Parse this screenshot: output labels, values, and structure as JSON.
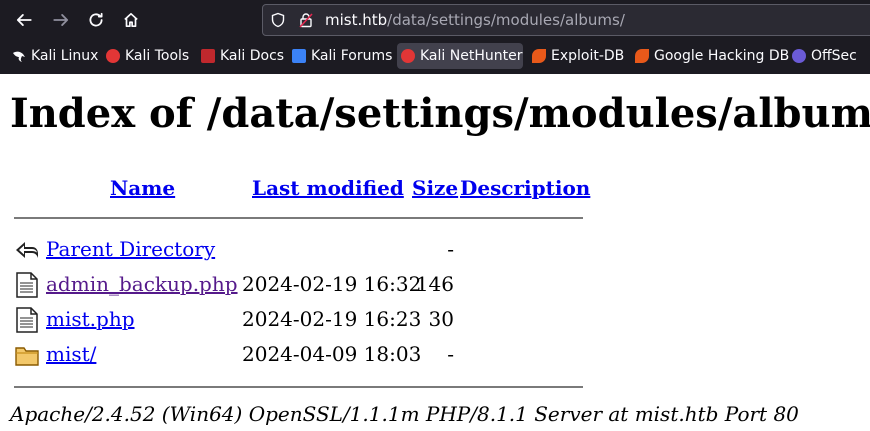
{
  "browser": {
    "url_host": "mist.htb",
    "url_path": "/data/settings/modules/albums/"
  },
  "bookmarks": [
    {
      "label": "Kali Linux",
      "icon": "kali-dragon-icon",
      "color": "#367bf0"
    },
    {
      "label": "Kali Tools",
      "icon": "kali-tools-icon",
      "color": "#e23636"
    },
    {
      "label": "Kali Docs",
      "icon": "kali-docs-icon",
      "color": "#c0282d"
    },
    {
      "label": "Kali Forums",
      "icon": "kali-forums-icon",
      "color": "#3b82f6"
    },
    {
      "label": "Kali NetHunter",
      "icon": "nethunter-icon",
      "color": "#e23636"
    },
    {
      "label": "Exploit-DB",
      "icon": "exploit-db-icon",
      "color": "#e8591a"
    },
    {
      "label": "Google Hacking DB",
      "icon": "ghdb-icon",
      "color": "#e8591a"
    },
    {
      "label": "OffSec",
      "icon": "offsec-icon",
      "color": "#6b5bd6"
    }
  ],
  "page": {
    "title": "Index of /data/settings/modules/albums",
    "columns": {
      "name": "Name",
      "modified": "Last modified",
      "size": "Size",
      "description": "Description"
    },
    "rows": [
      {
        "icon": "back-arrow-icon",
        "name": "Parent Directory",
        "modified": "",
        "size": "-"
      },
      {
        "icon": "text-file-icon",
        "name": "admin_backup.php",
        "modified": "2024-02-19 16:32",
        "size": "146"
      },
      {
        "icon": "text-file-icon",
        "name": "mist.php",
        "modified": "2024-02-19 16:23",
        "size": "30"
      },
      {
        "icon": "folder-icon",
        "name": "mist/",
        "modified": "2024-04-09 18:03",
        "size": "-"
      }
    ],
    "footer": "Apache/2.4.52 (Win64) OpenSSL/1.1.1m PHP/8.1.1 Server at mist.htb Port 80"
  }
}
